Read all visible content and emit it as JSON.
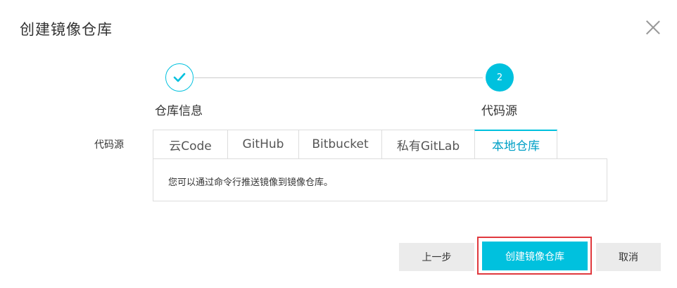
{
  "dialog": {
    "title": "创建镜像仓库"
  },
  "steps": [
    {
      "label": "仓库信息",
      "status": "done"
    },
    {
      "number": "2",
      "label": "代码源",
      "status": "current"
    }
  ],
  "source": {
    "label": "代码源",
    "tabs": [
      "云Code",
      "GitHub",
      "Bitbucket",
      "私有GitLab",
      "本地仓库"
    ],
    "active_tab": "本地仓库",
    "panel_text": "您可以通过命令行推送镜像到镜像仓库。"
  },
  "footer": {
    "prev_label": "上一步",
    "create_label": "创建镜像仓库",
    "cancel_label": "取消"
  },
  "colors": {
    "accent": "#00c1de",
    "highlight": "#e0393e",
    "secondary_button": "#ebebeb"
  },
  "icons": {
    "close": "close-icon",
    "check": "check-icon"
  }
}
